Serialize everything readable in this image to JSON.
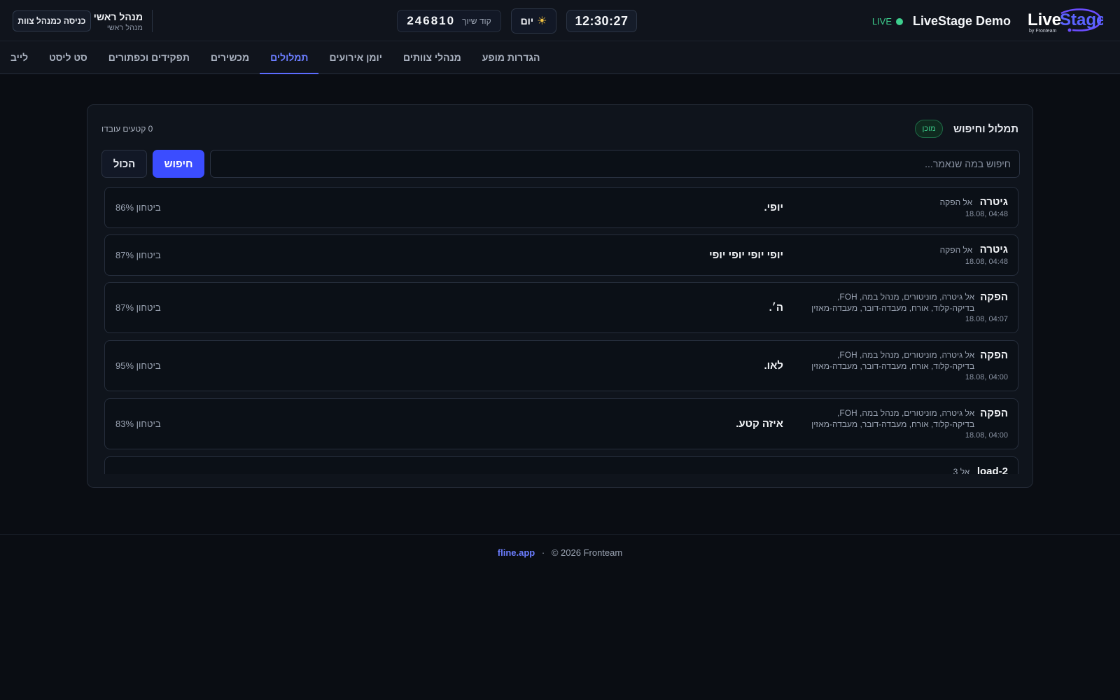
{
  "header": {
    "logo_text": "LiveStage",
    "logo_sub": "by Fronteam",
    "app_name": "LiveStage Demo",
    "live_label": "LIVE",
    "clock": "12:30:27",
    "theme_label": "יום",
    "theme_icon": "sun-icon",
    "code_label": "קוד שיוך",
    "code_value": "246810",
    "user_name": "מנהל ראשי",
    "user_role": "מנהל ראשי",
    "crew_button": "כניסה כמנהל צוות"
  },
  "nav": {
    "tabs": [
      {
        "label": "לייב",
        "active": false
      },
      {
        "label": "סט ליסט",
        "active": false
      },
      {
        "label": "תפקידים וכפתורים",
        "active": false
      },
      {
        "label": "מכשירים",
        "active": false
      },
      {
        "label": "תמלולים",
        "active": true
      },
      {
        "label": "יומן אירועים",
        "active": false
      },
      {
        "label": "מנהלי צוותים",
        "active": false
      },
      {
        "label": "הגדרות מופע",
        "active": false
      }
    ]
  },
  "panel": {
    "title": "תמלול וחיפוש",
    "status_badge": "מוכן",
    "processed": "0 קטעים עובדו",
    "search_placeholder": "חיפוש במה שנאמר...",
    "search_button": "חיפוש",
    "all_button": "הכול"
  },
  "transcripts": [
    {
      "source": "גיטרה",
      "to": "אל הפקה",
      "time": "18.08, 04:48",
      "text": "יופי.",
      "confidence": "ביטחון 86%"
    },
    {
      "source": "גיטרה",
      "to": "אל הפקה",
      "time": "18.08, 04:48",
      "text": "יופי יופי יופי יופי",
      "confidence": "ביטחון 87%"
    },
    {
      "source": "הפקה",
      "to": "אל גיטרה, מוניטורים, מנהל במה, FOH, בדיקה-קלוד, אורח, מעבדה-דובר, מעבדה-מאזין",
      "time": "18.08, 04:07",
      "text": "ה׳.",
      "confidence": "ביטחון 87%"
    },
    {
      "source": "הפקה",
      "to": "אל גיטרה, מוניטורים, מנהל במה, FOH, בדיקה-קלוד, אורח, מעבדה-דובר, מעבדה-מאזין",
      "time": "18.08, 04:00",
      "text": "לאו.",
      "confidence": "ביטחון 95%"
    },
    {
      "source": "הפקה",
      "to": "אל גיטרה, מוניטורים, מנהל במה, FOH, בדיקה-קלוד, אורח, מעבדה-דובר, מעבדה-מאזין",
      "time": "18.08, 04:00",
      "text": "איזה קטע.",
      "confidence": "ביטחון 83%"
    },
    {
      "source": "load-2",
      "to": "אל 3",
      "time": "",
      "text": "",
      "confidence": ""
    }
  ],
  "footer": {
    "link": "fline.app",
    "separator": "·",
    "copyright": "© 2026 Fronteam"
  },
  "colors": {
    "accent": "#3b4dff",
    "live": "#3ecf8e",
    "background": "#0a0d13"
  }
}
